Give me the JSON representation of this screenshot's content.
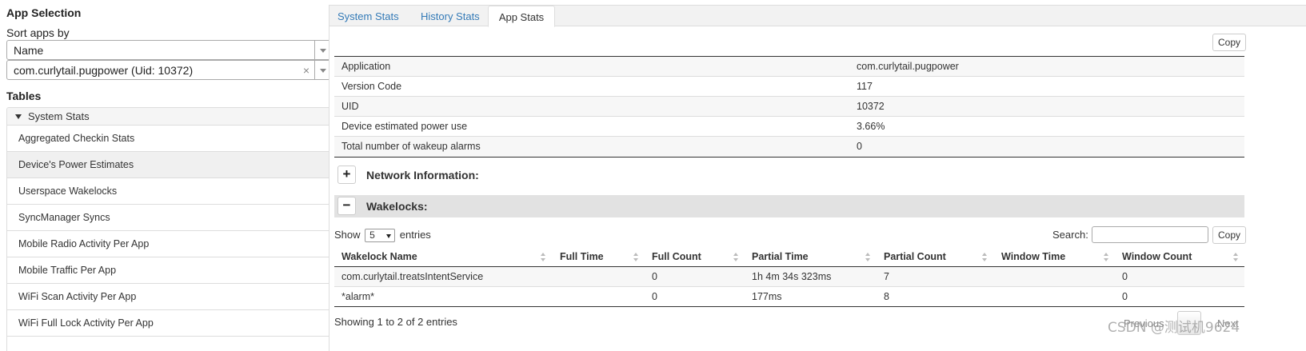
{
  "left": {
    "app_selection_heading": "App Selection",
    "sort_label": "Sort apps by",
    "sort_select_value": "Name",
    "app_select_value": "com.curlytail.pugpower (Uid: 10372)",
    "app_select_clear": "×",
    "tables_heading": "Tables",
    "tree_group_label": "System Stats",
    "tree_items": [
      {
        "label": "Aggregated Checkin Stats",
        "active": false
      },
      {
        "label": "Device's Power Estimates",
        "active": true
      },
      {
        "label": "Userspace Wakelocks",
        "active": false
      },
      {
        "label": "SyncManager Syncs",
        "active": false
      },
      {
        "label": "Mobile Radio Activity Per App",
        "active": false
      },
      {
        "label": "Mobile Traffic Per App",
        "active": false
      },
      {
        "label": "WiFi Scan Activity Per App",
        "active": false
      },
      {
        "label": "WiFi Full Lock Activity Per App",
        "active": false
      }
    ]
  },
  "tabs": [
    {
      "label": "System Stats",
      "active": false
    },
    {
      "label": "History Stats",
      "active": false
    },
    {
      "label": "App Stats",
      "active": true
    }
  ],
  "copy_label": "Copy",
  "app_info": [
    {
      "key": "Application",
      "value": "com.curlytail.pugpower"
    },
    {
      "key": "Version Code",
      "value": "117"
    },
    {
      "key": "UID",
      "value": "10372"
    },
    {
      "key": "Device estimated power use",
      "value": "3.66%"
    },
    {
      "key": "Total number of wakeup alarms",
      "value": "0"
    }
  ],
  "sections": {
    "network": {
      "toggle": "+",
      "title": "Network Information:"
    },
    "wakelocks": {
      "toggle": "−",
      "title": "Wakelocks:"
    }
  },
  "datatable": {
    "show_prefix": "Show",
    "page_length": "5",
    "show_suffix": "entries",
    "search_label": "Search:",
    "search_value": "",
    "columns": [
      "Wakelock Name",
      "Full Time",
      "Full Count",
      "Partial Time",
      "Partial Count",
      "Window Time",
      "Window Count"
    ],
    "rows": [
      [
        "com.curlytail.treatsIntentService",
        "",
        "0",
        "1h 4m 34s 323ms",
        "7",
        "",
        "0"
      ],
      [
        "*alarm*",
        "",
        "0",
        "177ms",
        "8",
        "",
        "0"
      ]
    ],
    "info": "Showing 1 to 2 of 2 entries",
    "prev_label": "Previous",
    "next_label": "Next"
  },
  "watermark": "CSDN @测试机9624"
}
